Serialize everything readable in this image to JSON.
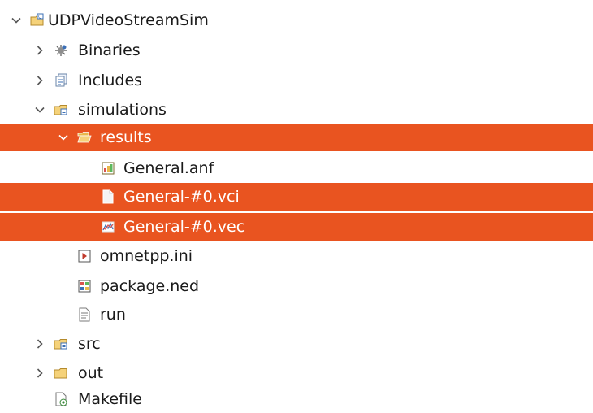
{
  "tree": {
    "project": {
      "label": "UDPVideoStreamSim",
      "icon": "project-folder-icon",
      "expanded": true
    },
    "binaries": {
      "label": "Binaries",
      "icon": "binaries-icon",
      "expanded": false
    },
    "includes": {
      "label": "Includes",
      "icon": "includes-icon",
      "expanded": false
    },
    "simulations": {
      "label": "simulations",
      "icon": "source-folder-icon",
      "expanded": true
    },
    "results": {
      "label": "results",
      "icon": "open-folder-icon",
      "expanded": true,
      "selected": true
    },
    "general_anf": {
      "label": "General.anf",
      "icon": "analysis-file-icon"
    },
    "general_vci": {
      "label": "General-#0.vci",
      "icon": "text-file-icon",
      "selected": true
    },
    "general_vec": {
      "label": "General-#0.vec",
      "icon": "vector-file-icon",
      "selected": true
    },
    "omnetpp_ini": {
      "label": "omnetpp.ini",
      "icon": "ini-file-icon"
    },
    "package_ned": {
      "label": "package.ned",
      "icon": "ned-file-icon"
    },
    "run": {
      "label": "run",
      "icon": "script-file-icon"
    },
    "src": {
      "label": "src",
      "icon": "source-folder-icon",
      "expanded": false
    },
    "out": {
      "label": "out",
      "icon": "folder-icon",
      "expanded": false
    },
    "makefile": {
      "label": "Makefile",
      "icon": "makefile-icon"
    }
  },
  "colors": {
    "selection": "#e95420",
    "text": "#1a1a1a",
    "folder": "#e8b84a",
    "accent": "#3b6fb6"
  }
}
